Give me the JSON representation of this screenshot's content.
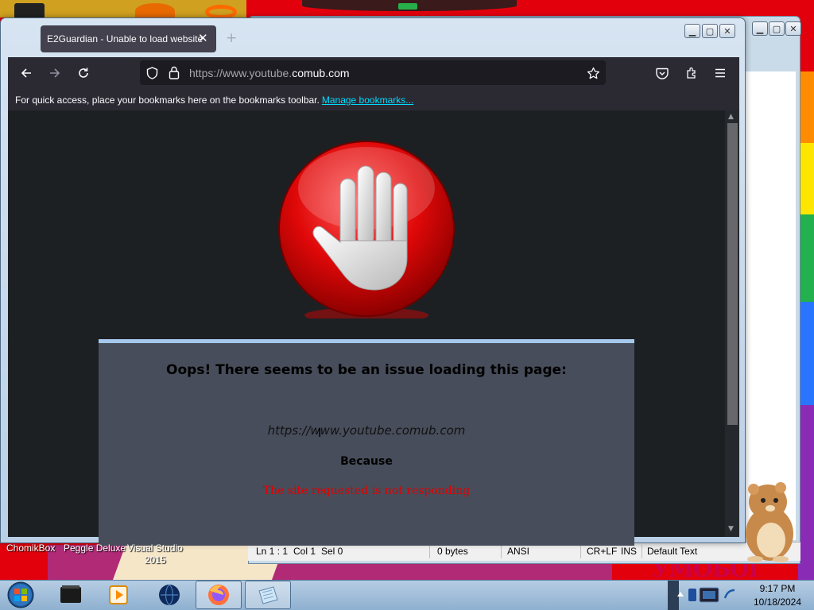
{
  "browser": {
    "tab_title": "E2Guardian - Unable to load website",
    "tab_close": "✕",
    "new_tab": "+",
    "url_prefix": "https://www.youtube.",
    "url_host": "comub.com",
    "bookmarks_message": "For quick access, place your bookmarks here on the bookmarks toolbar.",
    "bookmarks_link": "Manage bookmarks...",
    "icons": [
      "back-icon",
      "forward-icon",
      "reload-icon",
      "shield-icon",
      "lock-icon",
      "star-icon",
      "pocket-icon",
      "extensions-icon",
      "menu-icon"
    ]
  },
  "block_page": {
    "title": "Oops! There seems to be an issue loading this page:",
    "blocked_url": "https://www.youtube.comub.com",
    "because": "Because",
    "reason": "The site requested is not responding"
  },
  "notepad": {
    "status": {
      "position": "Ln 1 : 1",
      "col": "Col 1",
      "sel": "Sel 0",
      "size": "0 bytes",
      "encoding": "ANSI",
      "eol": "CR+LF",
      "mode": "INS",
      "style": "Default Text"
    }
  },
  "desktop": {
    "icon_labels": [
      "ChomikBox",
      "Peggle Deluxe",
      "Visual Studio",
      "2015"
    ],
    "wallpaper_text": "УМОБОГ"
  },
  "taskbar": {
    "apps": [
      "app-dark-icon",
      "media-player-icon",
      "globe-icon",
      "firefox-icon",
      "notepad-icon"
    ],
    "active_apps": [
      "firefox-icon",
      "notepad-icon"
    ],
    "time": "9:17 PM",
    "date": "10/18/2024"
  },
  "colors": {
    "browser_chrome": "#2b2a33",
    "page_bg": "#1d2023",
    "message_box": "#474d5a",
    "message_border": "#a6c8ec",
    "reason_text": "#e00000",
    "link": "#00ddff"
  }
}
